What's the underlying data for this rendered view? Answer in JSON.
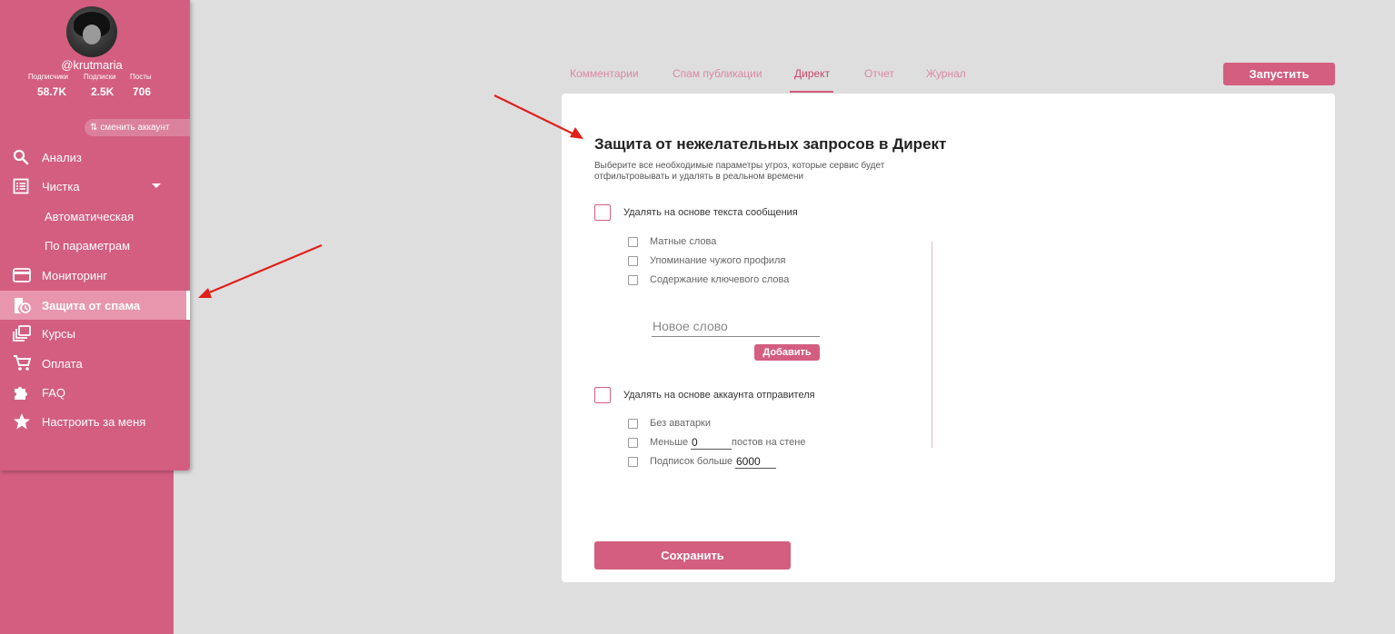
{
  "profile": {
    "username": "@krutmaria",
    "stats": [
      {
        "label": "Подписчики",
        "value": "58.7K"
      },
      {
        "label": "Подписки",
        "value": "2.5K"
      },
      {
        "label": "Посты",
        "value": "706"
      }
    ],
    "switch_account": "сменить аккаунт"
  },
  "sidebar": {
    "items": [
      {
        "label": "Анализ",
        "icon": "search-icon"
      },
      {
        "label": "Чистка",
        "icon": "list-icon"
      },
      {
        "label": "Автоматическая"
      },
      {
        "label": "По параметрам"
      },
      {
        "label": "Мониторинг",
        "icon": "card-icon"
      },
      {
        "label": "Защита от спама",
        "icon": "shield-clock-icon",
        "active": true
      },
      {
        "label": "Курсы",
        "icon": "library-icon"
      },
      {
        "label": "Оплата",
        "icon": "cart-icon"
      },
      {
        "label": "FAQ",
        "icon": "puzzle-icon"
      },
      {
        "label": "Настроить за меня",
        "icon": "star-icon"
      }
    ]
  },
  "tabs": [
    {
      "label": "Комментарии"
    },
    {
      "label": "Спам публикации"
    },
    {
      "label": "Директ",
      "active": true
    },
    {
      "label": "Отчет"
    },
    {
      "label": "Журнал"
    }
  ],
  "run_button": "Запустить",
  "card": {
    "title": "Защита от нежелательных запросов в Директ",
    "description": "Выберите все необходимые параметры угроз, которые сервис будет отфильтровывать и удалять в реальном времени",
    "section1": {
      "label": "Удалять на основе текста сообщения",
      "options": [
        "Матные слова",
        "Упоминание чужого профиля",
        "Содержание ключевого слова"
      ],
      "new_word_placeholder": "Новое слово",
      "add_button": "Добавить"
    },
    "section2": {
      "label": "Удалять на основе аккаунта отправителя",
      "no_avatar": "Без аватарки",
      "less_label": "Меньше",
      "less_value": "0",
      "posts_suffix": "постов на стене",
      "subs_label": "Подписок больше",
      "subs_value": "6000"
    },
    "save_button": "Сохранить"
  },
  "colors": {
    "accent": "#d35e80",
    "active_item": "#e796ad",
    "annotation_arrow": "#e0201a"
  }
}
